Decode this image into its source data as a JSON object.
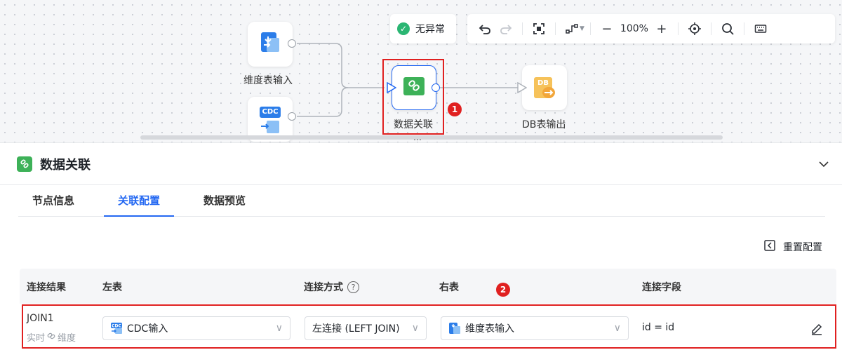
{
  "canvas": {
    "nodes": {
      "dim_input": {
        "label": "维度表输入",
        "icon": "dimension-table-icon"
      },
      "cdc_input": {
        "label": "",
        "icon_text": "CDC",
        "icon": "cdc-input-icon"
      },
      "data_join": {
        "label": "数据关联",
        "icon": "data-join-icon"
      },
      "db_output": {
        "label": "DB表输出",
        "icon_text": "DB",
        "icon": "db-output-icon"
      }
    },
    "markers": {
      "one": "1",
      "two": "2"
    }
  },
  "status": {
    "label": "无异常",
    "icon": "check-circle-icon",
    "color": "#2bb673"
  },
  "toolbar": {
    "zoom": "100%",
    "icons": [
      "undo-icon",
      "redo-icon",
      "fit-view-icon",
      "layout-icon",
      "zoom-out-icon",
      "zoom-in-icon",
      "locate-icon",
      "search-icon",
      "keyboard-icon"
    ]
  },
  "panel": {
    "title": "数据关联",
    "tabs": [
      {
        "label": "节点信息",
        "active": false
      },
      {
        "label": "关联配置",
        "active": true
      },
      {
        "label": "数据预览",
        "active": false
      }
    ],
    "reset_label": "重置配置",
    "table": {
      "headers": {
        "result": "连接结果",
        "left": "左表",
        "join_type": "连接方式",
        "right": "右表",
        "fields": "连接字段"
      },
      "row": {
        "name": "JOIN1",
        "sub_left": "实时",
        "sub_right": "维度",
        "left_table": "CDC输入",
        "join_type": "左连接 (LEFT JOIN)",
        "right_table": "维度表输入",
        "fields": "id = id"
      }
    }
  },
  "colors": {
    "accent": "#2468f2",
    "highlight": "#e02020",
    "join_node": "#3db158"
  }
}
